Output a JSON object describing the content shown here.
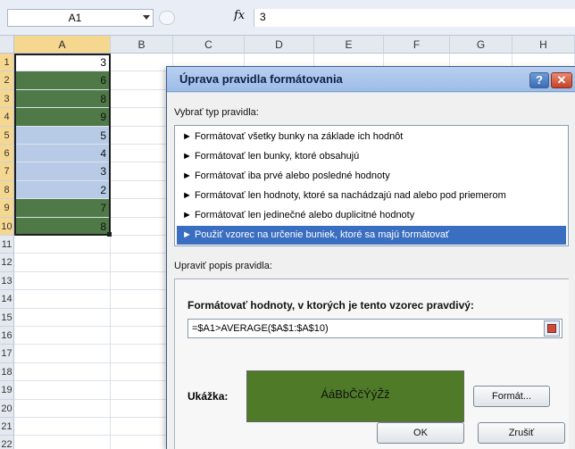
{
  "formula_bar": {
    "name_box": "A1",
    "fx_label": "fx",
    "formula": "3"
  },
  "columns": [
    "A",
    "B",
    "C",
    "D",
    "E",
    "F",
    "G",
    "H"
  ],
  "rows": [
    "1",
    "2",
    "3",
    "4",
    "5",
    "6",
    "7",
    "8",
    "9",
    "10",
    "11",
    "12",
    "13",
    "14",
    "15",
    "16",
    "17",
    "18",
    "19",
    "20",
    "21",
    "22"
  ],
  "cells_A": [
    {
      "value": "3",
      "fill": "none"
    },
    {
      "value": "6",
      "fill": "green"
    },
    {
      "value": "8",
      "fill": "green"
    },
    {
      "value": "9",
      "fill": "green"
    },
    {
      "value": "5",
      "fill": "blue"
    },
    {
      "value": "4",
      "fill": "blue"
    },
    {
      "value": "3",
      "fill": "blue"
    },
    {
      "value": "2",
      "fill": "blue"
    },
    {
      "value": "7",
      "fill": "green"
    },
    {
      "value": "8",
      "fill": "green"
    }
  ],
  "dialog": {
    "title": "Úprava pravidla formátovania",
    "help_icon": "?",
    "close_icon": "✕",
    "select_type_label": "Vybrať typ pravidla:",
    "rule_types": [
      "► Formátovať všetky bunky na základe ich hodnôt",
      "► Formátovať len bunky, ktoré obsahujú",
      "► Formátovať iba prvé alebo posledné hodnoty",
      "► Formátovať len hodnoty, ktoré sa nachádzajú nad alebo pod priemerom",
      "► Formátovať len jedinečné alebo duplicitné hodnoty",
      "► Použiť vzorec na určenie buniek, ktoré sa majú formátovať"
    ],
    "selected_rule_index": 5,
    "edit_description_label": "Upraviť popis pravidla:",
    "formula_heading": "Formátovať hodnoty, v ktorých je tento vzorec pravdivý:",
    "formula_value": "=$A1>AVERAGE($A$1:$A$10)",
    "preview_label": "Ukážka:",
    "preview_text": "ÁáBbČčÝýŽž",
    "format_button": "Formát...",
    "ok_button": "OK",
    "cancel_button": "Zrušiť"
  },
  "colors": {
    "green_fill": "#4f7a48",
    "blue_fill": "#b8cbe6",
    "preview_fill": "#4f7a28",
    "selected_rule": "#3a6ec0"
  }
}
